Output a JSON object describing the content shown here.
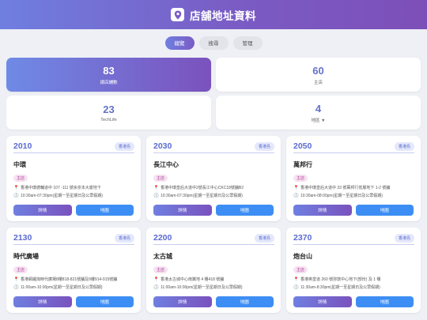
{
  "header": {
    "title": "店舖地址資料",
    "icon": "map-pin-icon"
  },
  "tabs": [
    "總覽",
    "搜尋",
    "管理"
  ],
  "stats": [
    {
      "value": "83",
      "label": "總店舖數"
    },
    {
      "value": "60",
      "label": "主店"
    },
    {
      "value": "23",
      "label": "TechLife"
    },
    {
      "value": "4",
      "label": "地區 ▼"
    }
  ],
  "stores": [
    {
      "code": "2010",
      "region": "香港島",
      "name": "中環",
      "type": "主店",
      "address": "香港中環德輔道中 107 -111 號余崇本大廈地下",
      "hours": "10:30am-07:30pm(星期一至星期日及公眾假期)",
      "detail": "詳情",
      "map": "地圖"
    },
    {
      "code": "2030",
      "region": "香港島",
      "name": "長江中心",
      "type": "主店",
      "address": "香港中環皇后大道中2號長江中心CKC18號舖B2",
      "hours": "10:30am-07:30pm(星期一至星期日及公眾假期)",
      "detail": "詳情",
      "map": "地圖"
    },
    {
      "code": "2050",
      "region": "香港島",
      "name": "萬邦行",
      "type": "主店",
      "address": "香港中環皇后大道中 33 號萬邦行低層地下 1-2 號舖",
      "hours": "10:30am-08:00pm(星期一至星期日及公眾假期)",
      "detail": "詳情",
      "map": "地圖"
    },
    {
      "code": "2130",
      "region": "香港島",
      "name": "時代廣場",
      "type": "主店",
      "address": "香港銅鑼灣時代廣場8樓818-821號舖及9樓914-915號舖",
      "hours": "11:00am-10:00pm(星期一至星期日及公眾假期)",
      "detail": "詳情",
      "map": "地圖"
    },
    {
      "code": "2200",
      "region": "香港島",
      "name": "太古城",
      "type": "主店",
      "address": "香港太古城中心南翼地 4 樓418 號舖",
      "hours": "11:00am-10:00pm(星期一至星期日及公眾假期)",
      "detail": "詳情",
      "map": "地圖"
    },
    {
      "code": "2370",
      "region": "香港島",
      "name": "炮台山",
      "type": "主店",
      "address": "香港英皇道 260 號弥敦中心地下(部份) 及 1 樓",
      "hours": "11:30am-8:30pm(星期一至星期日及公眾假期)",
      "detail": "詳情",
      "map": "地圖"
    }
  ],
  "colors": {
    "accent_start": "#6f7fe0",
    "accent_end": "#7a52be",
    "map_button": "#3d8ef4",
    "badge_text": "#b33c9a"
  }
}
